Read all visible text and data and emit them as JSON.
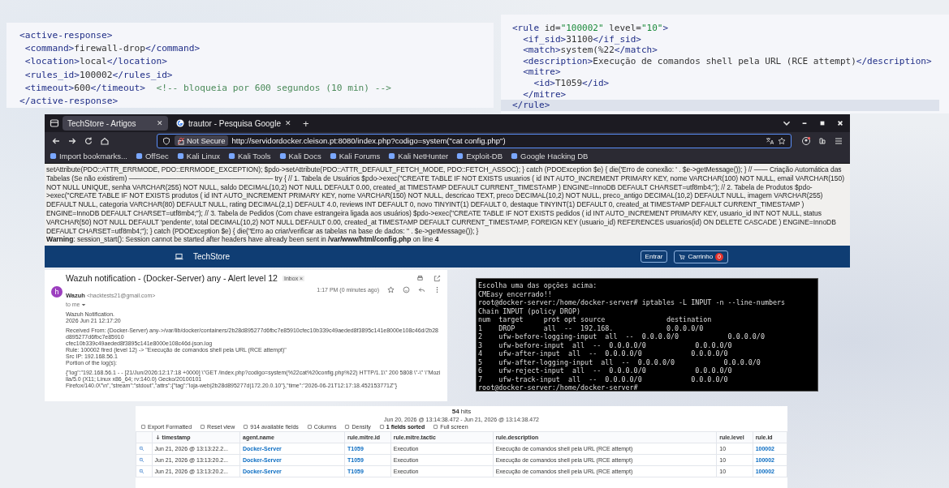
{
  "code_panels": [
    {
      "lines": [
        {
          "highlighted": false,
          "tokens": [
            {
              "kind": "tag",
              "text": "<active-response>"
            }
          ]
        },
        {
          "highlighted": false,
          "tokens": [
            {
              "kind": "tag",
              "text": " <command>"
            },
            {
              "kind": "text",
              "text": "firewall-drop"
            },
            {
              "kind": "tag",
              "text": "</command>"
            }
          ]
        },
        {
          "highlighted": false,
          "tokens": [
            {
              "kind": "tag",
              "text": " <location>"
            },
            {
              "kind": "text",
              "text": "local"
            },
            {
              "kind": "tag",
              "text": "</location>"
            }
          ]
        },
        {
          "highlighted": false,
          "tokens": [
            {
              "kind": "tag",
              "text": " <rules_id>"
            },
            {
              "kind": "text",
              "text": "100002"
            },
            {
              "kind": "tag",
              "text": "</rules_id>"
            }
          ]
        },
        {
          "highlighted": false,
          "tokens": [
            {
              "kind": "tag",
              "text": " <timeout>"
            },
            {
              "kind": "text",
              "text": "600"
            },
            {
              "kind": "tag",
              "text": "</timeout>"
            },
            {
              "kind": "comment",
              "text": "  <!-- bloqueia por 600 segundos (10 min) -->"
            }
          ]
        },
        {
          "highlighted": false,
          "tokens": [
            {
              "kind": "tag",
              "text": "</active-response>"
            }
          ]
        }
      ]
    },
    {
      "lines": [
        {
          "highlighted": false,
          "tokens": [
            {
              "kind": "tag",
              "text": "<rule "
            },
            {
              "kind": "text",
              "text": "id="
            },
            {
              "kind": "string",
              "text": "\"100002\""
            },
            {
              "kind": "text",
              "text": " level="
            },
            {
              "kind": "string",
              "text": "\"10\""
            },
            {
              "kind": "tag",
              "text": ">"
            }
          ]
        },
        {
          "highlighted": false,
          "tokens": [
            {
              "kind": "tag",
              "text": "  <if_sid>"
            },
            {
              "kind": "text",
              "text": "31100"
            },
            {
              "kind": "tag",
              "text": "</if_sid>"
            }
          ]
        },
        {
          "highlighted": false,
          "tokens": [
            {
              "kind": "tag",
              "text": "  <match>"
            },
            {
              "kind": "text",
              "text": "system(%22"
            },
            {
              "kind": "tag",
              "text": "</match>"
            }
          ]
        },
        {
          "highlighted": false,
          "tokens": [
            {
              "kind": "tag",
              "text": "  <description>"
            },
            {
              "kind": "text",
              "text": "Execução de comandos shell pela URL (RCE attempt)"
            },
            {
              "kind": "tag",
              "text": "</description>"
            }
          ]
        },
        {
          "highlighted": false,
          "tokens": [
            {
              "kind": "tag",
              "text": "  <mitre>"
            }
          ]
        },
        {
          "highlighted": false,
          "tokens": [
            {
              "kind": "tag",
              "text": "    <id>"
            },
            {
              "kind": "text",
              "text": "T1059"
            },
            {
              "kind": "tag",
              "text": "</id>"
            }
          ]
        },
        {
          "highlighted": false,
          "tokens": [
            {
              "kind": "tag",
              "text": "  </mitre>"
            }
          ]
        },
        {
          "highlighted": true,
          "tokens": [
            {
              "kind": "tag",
              "text": "</rule>"
            }
          ]
        }
      ]
    }
  ],
  "browser": {
    "tabs": [
      {
        "title": "TechStore - Artigos",
        "selected": true,
        "close": "✕"
      },
      {
        "title": "trautor - Pesquisa Google",
        "selected": false,
        "close": "✕"
      }
    ],
    "new_tab": "+",
    "security": "Not Secure",
    "url": "http://servidordocker.cleison.pt:8080/index.php?codigo=system(\"cat config.php\")",
    "bookmarks": [
      "Import bookmarks...",
      "OffSec",
      "Kali Linux",
      "Kali Tools",
      "Kali Docs",
      "Kali Forums",
      "Kali NetHunter",
      "Exploit-DB",
      "Google Hacking DB"
    ],
    "page_text": "setAttribute(PDO::ATTR_ERRMODE, PDO::ERRMODE_EXCEPTION); $pdo->setAttribute(PDO::ATTR_DEFAULT_FETCH_MODE, PDO::FETCH_ASSOC); } catch (PDOException $e) { die('Erro de conexão: ' . $e->getMessage()); } // —— Criação Automática das Tabelas (Se não existirem) ————————————————————— try { // 1. Tabela de Usuários $pdo->exec(\"CREATE TABLE IF NOT EXISTS usuarios ( id INT AUTO_INCREMENT PRIMARY KEY, nome VARCHAR(100) NOT NULL, email VARCHAR(150) NOT NULL UNIQUE, senha VARCHAR(255) NOT NULL, saldo DECIMAL(10,2) NOT NULL DEFAULT 0.00, created_at TIMESTAMP DEFAULT CURRENT_TIMESTAMP ) ENGINE=InnoDB DEFAULT CHARSET=utf8mb4;\"); // 2. Tabela de Produtos $pdo->exec(\"CREATE TABLE IF NOT EXISTS produtos ( id INT AUTO_INCREMENT PRIMARY KEY, nome VARCHAR(150) NOT NULL, descricao TEXT, preco DECIMAL(10,2) NOT NULL, preco_antigo DECIMAL(10,2) DEFAULT NULL, imagem VARCHAR(255) DEFAULT NULL, categoria VARCHAR(80) DEFAULT NULL, rating DECIMAL(2,1) DEFAULT 4.0, reviews INT DEFAULT 0, novo TINYINT(1) DEFAULT 0, destaque TINYINT(1) DEFAULT 0, created_at TIMESTAMP DEFAULT CURRENT_TIMESTAMP ) ENGINE=InnoDB DEFAULT CHARSET=utf8mb4;\"); // 3. Tabela de Pedidos (Com chave estrangeira ligada aos usuários) $pdo->exec(\"CREATE TABLE IF NOT EXISTS pedidos ( id INT AUTO_INCREMENT PRIMARY KEY, usuario_id INT NOT NULL, status VARCHAR(50) NOT NULL DEFAULT 'pendente', total DECIMAL(10,2) NOT NULL DEFAULT 0.00, created_at TIMESTAMP DEFAULT CURRENT_TIMESTAMP, FOREIGN KEY (usuario_id) REFERENCES usuarios(id) ON DELETE CASCADE ) ENGINE=InnoDB DEFAULT CHARSET=utf8mb4;\"); } catch (PDOException $e) { die(\"Erro ao criar/verificar as tabelas na base de dados: \" . $e->getMessage()); }",
    "warning": "**Warning**: session_start(): Session cannot be started after headers have already been sent in **/var/www/html/config.php** on line **4**",
    "brand": "TechStore",
    "login": "Entrar",
    "cart": "Carrinho",
    "cart_count": "0"
  },
  "email": {
    "subject": "Wazuh notification - (Docker-Server) any - Alert level 12",
    "label": "Inbox ×",
    "avatar": "h",
    "sender": "Wazuh",
    "sender_email": "<hacktests21@gmail.com>",
    "to": "to me",
    "time": "1:17 PM (0 minutes ago)",
    "paragraphs": [
      [
        "Wazuh Notification.",
        "2026 Jun 21 12:17:20"
      ],
      [
        "Received From: (Docker-Server) any->/var/lib/docker/containers/2b28d895277d6fbc7e85910cfec10b339c49aeded8f3895c141e8000e108c46d/2b28d895277d6fbc7e85910",
        "cfec10b339c49aeded8f3895c141e8000e108c46d-json.log",
        "Rule: 100002 fired (level 12) -> \"Execução de comandos shell pela URL (RCE attempt)\"",
        "Src IP: 192.168.56.1",
        "Portion of the log(s):"
      ],
      [
        "{\"log\":\"192.168.56.1 - - [21/Jun/2026:12:17:18 +0000] \\\"GET /index.php?codigo=system(%22cat%20config.php%22) HTTP/1.1\\\" 200 5808 \\\"-\\\" \\\"Mozilla/5.0 (X11; Linux x86_64; rv:140.0) Gecko/20100101",
        "Firefox/140.0\\\"\\n\",\"stream\":\"stdout\",\"attrs\":{\"tag\":\"loja-web|2b28d895277d|172.20.0.10\"},\"time\":\"2026-06-21T12:17:18.452153771Z\"}"
      ]
    ]
  },
  "terminal": {
    "lines": [
      "Escolha uma das opções acima:",
      "CMEasy encerrado!!",
      "root@docker-server:/home/docker-server# iptables -L INPUT -n --line-numbers",
      "Chain INPUT (policy DROP)",
      "num  target     prot opt source               destination",
      "1    DROP       all  --  192.168.             0.0.0.0/0",
      "2    ufw-before-logging-input  all  --  0.0.0.0/0            0.0.0.0/0",
      "3    ufw-before-input  all  --  0.0.0.0/0            0.0.0.0/0",
      "4    ufw-after-input  all  --  0.0.0.0/0            0.0.0.0/0",
      "5    ufw-after-logging-input  all  --  0.0.0.0/0            0.0.0.0/0",
      "6    ufw-reject-input  all  --  0.0.0.0/0            0.0.0.0/0",
      "7    ufw-track-input  all  --  0.0.0.0/0            0.0.0.0/0",
      "root@docker-server:/home/docker-server#"
    ]
  },
  "discover": {
    "hits_count": "54",
    "hits_label": "hits",
    "range": "Jun 20, 2026 @ 13:14:38.472 - Jun 21, 2026 @ 13:14:38.472",
    "toolbar": [
      {
        "label": "Export Formatted",
        "bold": false
      },
      {
        "label": "Reset view",
        "bold": false
      },
      {
        "label": "914 available fields",
        "bold": false
      },
      {
        "label": "Columns",
        "bold": false
      },
      {
        "label": "Density",
        "bold": false
      },
      {
        "label": "1 fields sorted",
        "bold": true
      },
      {
        "label": "Full screen",
        "bold": false
      }
    ],
    "columns": [
      {
        "label": "timestamp",
        "sorted": true,
        "kind": "text"
      },
      {
        "label": "agent.name",
        "sorted": false,
        "kind": "link"
      },
      {
        "label": "rule.mitre.id",
        "sorted": false,
        "kind": "link"
      },
      {
        "label": "rule.mitre.tactic",
        "sorted": false,
        "kind": "text"
      },
      {
        "label": "rule.description",
        "sorted": false,
        "kind": "text"
      },
      {
        "label": "rule.level",
        "sorted": false,
        "kind": "text"
      },
      {
        "label": "rule.id",
        "sorted": false,
        "kind": "link"
      }
    ],
    "rows": [
      [
        "Jun 21, 2026 @ 13:13:22.2...",
        "Docker-Server",
        "T1059",
        "Execution",
        "Execução de comandos shell pela URL (RCE attempt)",
        "10",
        "100002"
      ],
      [
        "Jun 21, 2026 @ 13:13:20.2...",
        "Docker-Server",
        "T1059",
        "Execution",
        "Execução de comandos shell pela URL (RCE attempt)",
        "10",
        "100002"
      ],
      [
        "Jun 21, 2026 @ 13:13:20.2...",
        "Docker-Server",
        "T1059",
        "Execution",
        "Execução de comandos shell pela URL (RCE attempt)",
        "10",
        "100002"
      ]
    ]
  }
}
